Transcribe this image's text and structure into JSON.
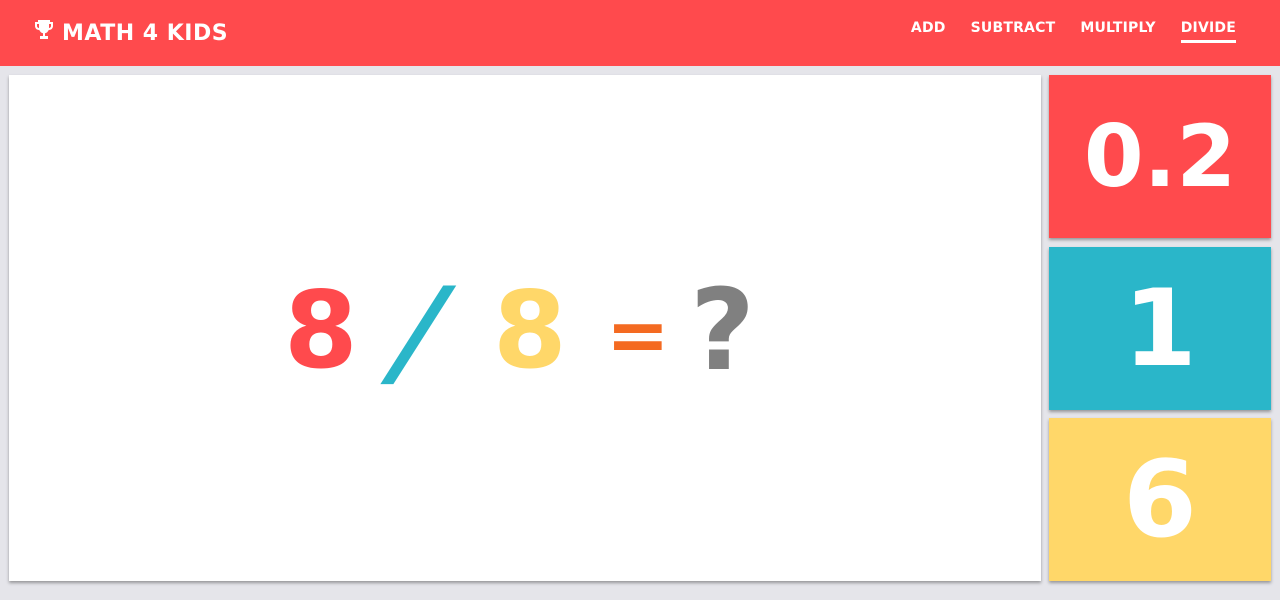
{
  "brand": {
    "title": "MATH 4 KIDS",
    "icon": "trophy-icon"
  },
  "nav": {
    "items": [
      {
        "label": "ADD",
        "active": false
      },
      {
        "label": "SUBTRACT",
        "active": false
      },
      {
        "label": "MULTIPLY",
        "active": false
      },
      {
        "label": "DIVIDE",
        "active": true
      }
    ]
  },
  "equation": {
    "left_operand": "8",
    "operator": "/",
    "right_operand": "8",
    "equals": "=",
    "unknown": "?"
  },
  "answers": [
    {
      "value": "0.2",
      "color": "#ff4a4d"
    },
    {
      "value": "1",
      "color": "#2ab6c9"
    },
    {
      "value": "6",
      "color": "#ffd769"
    }
  ],
  "colors": {
    "header": "#ff4a4d",
    "left_operand": "#ff4a4d",
    "operator": "#2ab6c9",
    "right_operand": "#ffd769",
    "equals": "#f46a21",
    "unknown": "#808080",
    "background": "#e5e5ea"
  }
}
